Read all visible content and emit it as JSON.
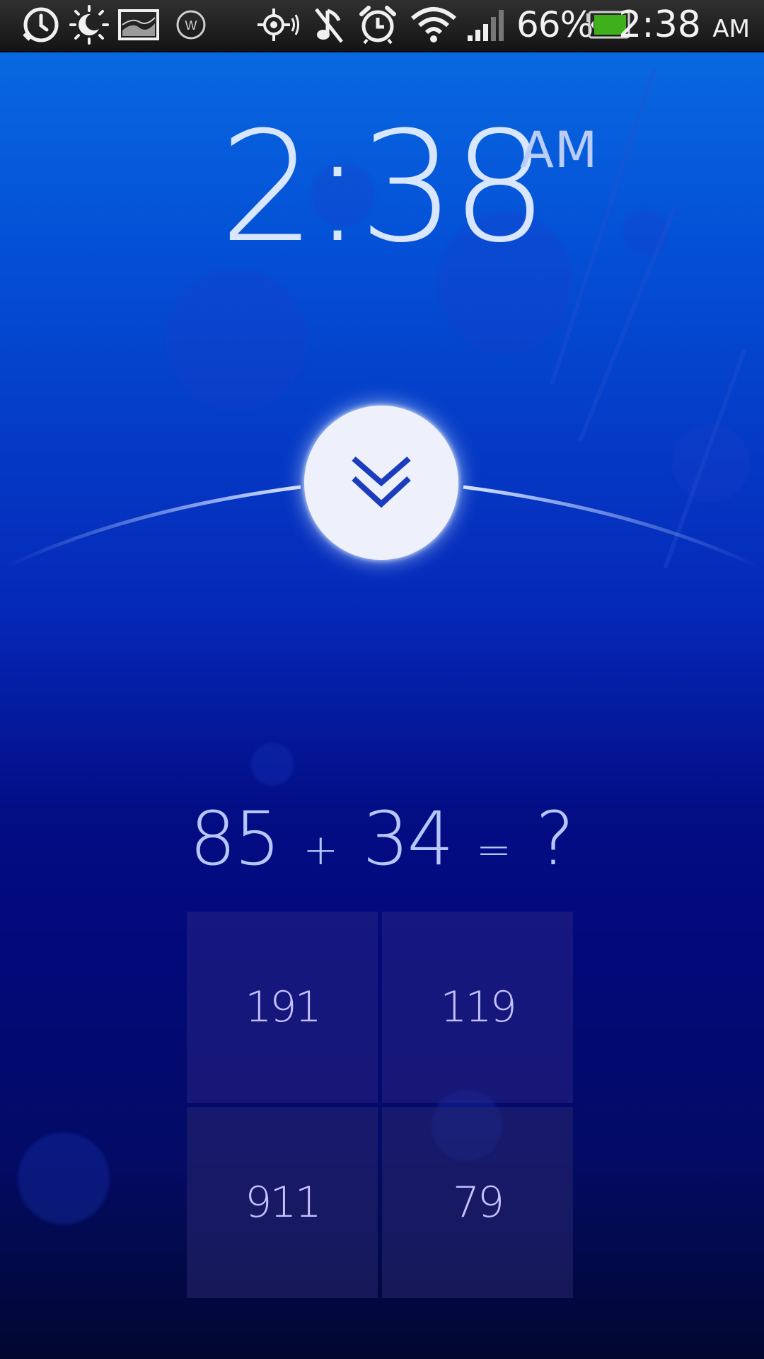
{
  "status_bar": {
    "battery_percent": "66%",
    "time": "2:38",
    "ampm": "AM",
    "icons": [
      "alarm-clock-icon",
      "brightness-icon",
      "image-icon",
      "widget-w-icon",
      "gps-icon",
      "mute-music-icon",
      "alarm-icon",
      "wifi-icon",
      "signal-icon",
      "battery-icon"
    ]
  },
  "clock": {
    "time": "2:38",
    "ampm": "AM"
  },
  "dismiss": {
    "icon": "double-chevron-down-icon"
  },
  "problem": {
    "a": "85",
    "op": "+",
    "b": "34",
    "eq": "=",
    "q": "?"
  },
  "answers": [
    "191",
    "119",
    "911",
    "79"
  ],
  "colors": {
    "accent": "#0528b8",
    "text": "#b8c6ff"
  }
}
